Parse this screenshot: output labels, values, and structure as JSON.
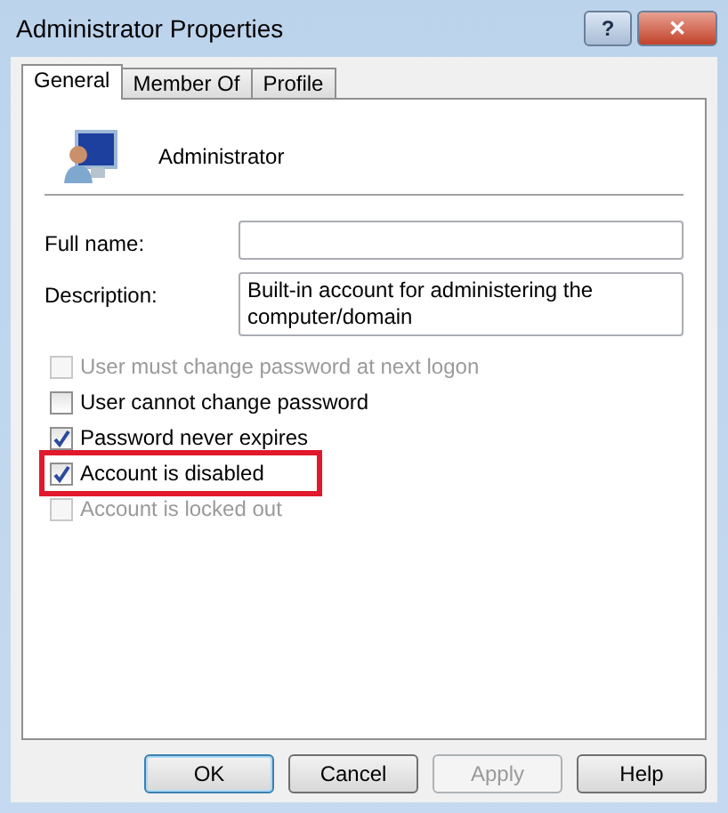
{
  "window": {
    "title": "Administrator Properties",
    "controls": [
      "?",
      "✕"
    ]
  },
  "tabs": [
    {
      "label": "General",
      "selected": true
    },
    {
      "label": "Member Of",
      "selected": false
    },
    {
      "label": "Profile",
      "selected": false
    }
  ],
  "account": {
    "name": "Administrator"
  },
  "fields": [
    {
      "label": "Full name:"
    },
    {
      "label": "Description:",
      "value": "Built-in account for administering the computer/domain"
    }
  ],
  "checkboxes": [
    {
      "label": "User must change password at next logon",
      "checked": false,
      "disabled": true,
      "highlighted": false
    },
    {
      "label": "User cannot change password",
      "checked": false,
      "disabled": false,
      "highlighted": false
    },
    {
      "label": "Password never expires",
      "checked": true,
      "disabled": false,
      "highlighted": false
    },
    {
      "label": "Account is disabled",
      "checked": true,
      "disabled": false,
      "highlighted": true
    },
    {
      "label": "Account is locked out",
      "checked": false,
      "disabled": true,
      "highlighted": false
    }
  ],
  "buttons": [
    {
      "label": "OK",
      "default": true,
      "disabled": false
    },
    {
      "label": "Cancel",
      "default": false,
      "disabled": false
    },
    {
      "label": "Apply",
      "default": false,
      "disabled": true
    },
    {
      "label": "Help",
      "default": false,
      "disabled": false
    }
  ]
}
